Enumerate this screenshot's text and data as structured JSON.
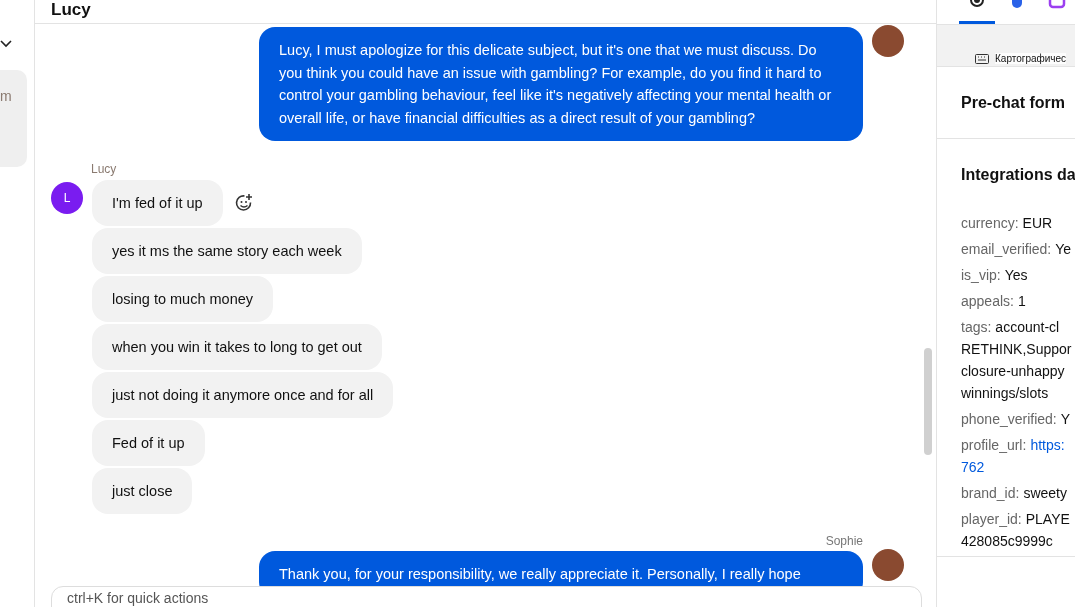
{
  "sidebar": {
    "card_text": "m"
  },
  "header": {
    "title": "Lucy"
  },
  "groups": [
    {
      "kind": "agent",
      "messages": [
        {
          "text": "Lucy, I must apologize for this delicate subject, but it's one that we must discuss. Do you think you could have an issue with gambling? For example, do you find it hard to control your gambling behaviour, feel like it's negatively affecting your mental health or overall life, or have financial difficulties as a direct result of your gambling?"
        }
      ]
    },
    {
      "kind": "customer",
      "name": "Lucy",
      "initial": "L",
      "messages": [
        {
          "text": "I'm fed of it up",
          "reaction_button": true
        },
        {
          "text": "yes it ms the same story each week",
          "reaction_button": false
        },
        {
          "text": "losing to much money",
          "reaction_button": false
        },
        {
          "text": "when you win it takes to long to get out",
          "reaction_button": false
        },
        {
          "text": "just not doing it anymore once and for all",
          "reaction_button": false
        },
        {
          "text": "Fed of it up",
          "reaction_button": false
        },
        {
          "text": "just close",
          "reaction_button": false
        }
      ]
    },
    {
      "kind": "agent",
      "name": "Sophie",
      "messages": [
        {
          "text": "Thank you, for your responsibility, we really appreciate it. Personally, I really hope"
        }
      ]
    }
  ],
  "composer": {
    "placeholder": "ctrl+K for quick actions"
  },
  "details": {
    "tabs": [
      {
        "kind": "profile",
        "selected": true
      },
      {
        "kind": "integration",
        "selected": false
      },
      {
        "kind": "plugin",
        "selected": false
      }
    ],
    "map_attribution": "Картографичес",
    "sections": [
      {
        "title": "Pre-chat form"
      },
      {
        "title": "Integrations da",
        "fields": [
          {
            "key": "currency:",
            "lines": [
              "EUR"
            ],
            "kind": "text"
          },
          {
            "key": "email_verified:",
            "lines": [
              "Ye"
            ],
            "kind": "text"
          },
          {
            "key": "is_vip:",
            "lines": [
              "Yes"
            ],
            "kind": "text"
          },
          {
            "key": "appeals:",
            "lines": [
              "1"
            ],
            "kind": "text"
          },
          {
            "key": "tags:",
            "lines": [
              "account-cl",
              "RETHINK,Suppor",
              "closure-unhappy",
              "winnings/slots"
            ],
            "kind": "text"
          },
          {
            "key": "phone_verified:",
            "lines": [
              "Y"
            ],
            "kind": "text"
          },
          {
            "key": "profile_url:",
            "lines": [
              "https:",
              "762"
            ],
            "kind": "link"
          },
          {
            "key": "brand_id:",
            "lines": [
              "sweety"
            ],
            "kind": "text"
          },
          {
            "key": "player_id:",
            "lines": [
              "PLAYE",
              "428085c9999c"
            ],
            "kind": "text"
          }
        ]
      }
    ]
  }
}
